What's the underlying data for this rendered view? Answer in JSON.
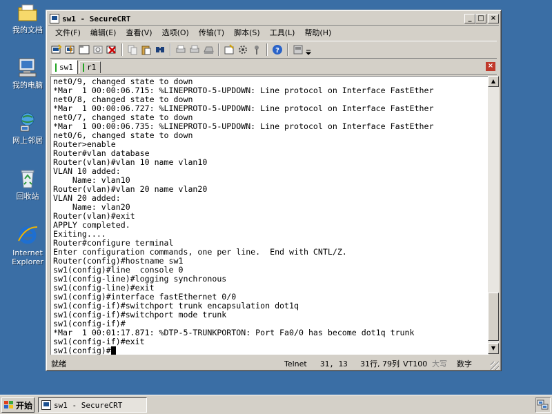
{
  "desktop": {
    "icons": [
      {
        "label": "我的文档",
        "icon": "my-documents-icon"
      },
      {
        "label": "我的电脑",
        "icon": "my-computer-icon"
      },
      {
        "label": "网上邻居",
        "icon": "network-places-icon"
      },
      {
        "label": "回收站",
        "icon": "recycle-bin-icon"
      },
      {
        "label": "Internet Explorer",
        "icon": "internet-explorer-icon"
      }
    ]
  },
  "window": {
    "title": "sw1 - SecureCRT",
    "controls": {
      "minimize": "_",
      "maximize": "□",
      "close": "×"
    }
  },
  "menu": [
    "文件(F)",
    "编辑(E)",
    "查看(V)",
    "选项(O)",
    "传输(T)",
    "脚本(S)",
    "工具(L)",
    "帮助(H)"
  ],
  "tabs": [
    {
      "label": "sw1",
      "active": true
    },
    {
      "label": "r1",
      "active": false
    }
  ],
  "tab_close": "×",
  "terminal": {
    "lines": [
      "net0/9, changed state to down",
      "*Mar  1 00:00:06.715: %LINEPROTO-5-UPDOWN: Line protocol on Interface FastEther",
      "net0/8, changed state to down",
      "*Mar  1 00:00:06.727: %LINEPROTO-5-UPDOWN: Line protocol on Interface FastEther",
      "net0/7, changed state to down",
      "*Mar  1 00:00:06.735: %LINEPROTO-5-UPDOWN: Line protocol on Interface FastEther",
      "net0/6, changed state to down",
      "Router>enable",
      "Router#vlan database",
      "Router(vlan)#vlan 10 name vlan10",
      "VLAN 10 added:",
      "    Name: vlan10",
      "Router(vlan)#vlan 20 name vlan20",
      "VLAN 20 added:",
      "    Name: vlan20",
      "Router(vlan)#exit",
      "APPLY completed.",
      "Exiting....",
      "Router#configure terminal",
      "Enter configuration commands, one per line.  End with CNTL/Z.",
      "Router(config)#hostname sw1",
      "sw1(config)#line  console 0",
      "sw1(config-line)#logging synchronous",
      "sw1(config-line)#exit",
      "sw1(config)#interface fastEthernet 0/0",
      "sw1(config-if)#switchport trunk encapsulation dot1q",
      "sw1(config-if)#switchport mode trunk",
      "sw1(config-if)#",
      "*Mar  1 00:01:17.871: %DTP-5-TRUNKPORTON: Port Fa0/0 has become dot1q trunk",
      "sw1(config-if)#exit",
      "sw1(config)#"
    ]
  },
  "status": {
    "ready": "就绪",
    "protocol": "Telnet",
    "position": "31,  13",
    "size": "31行, 79列",
    "terminal_type": "VT100",
    "caps": "大写",
    "num": "数字"
  },
  "taskbar": {
    "start": "开始",
    "task": "sw1 - SecureCRT"
  },
  "colors": {
    "desktop": "#3a6ea5",
    "window_face": "#d4d0c8",
    "terminal_bg": "#ffffff",
    "tab_close": "#c0392b"
  }
}
